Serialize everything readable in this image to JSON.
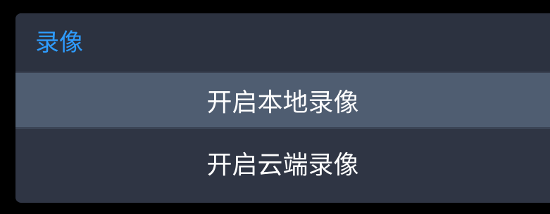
{
  "dialog": {
    "title": "录像",
    "title_color": "#2e9cff",
    "background": "#2f3544",
    "items": [
      {
        "label": "开启本地录像",
        "state": "highlighted",
        "background": "#4f5d71"
      },
      {
        "label": "开启云端录像",
        "state": "normal",
        "background": "#2f3544"
      }
    ]
  }
}
